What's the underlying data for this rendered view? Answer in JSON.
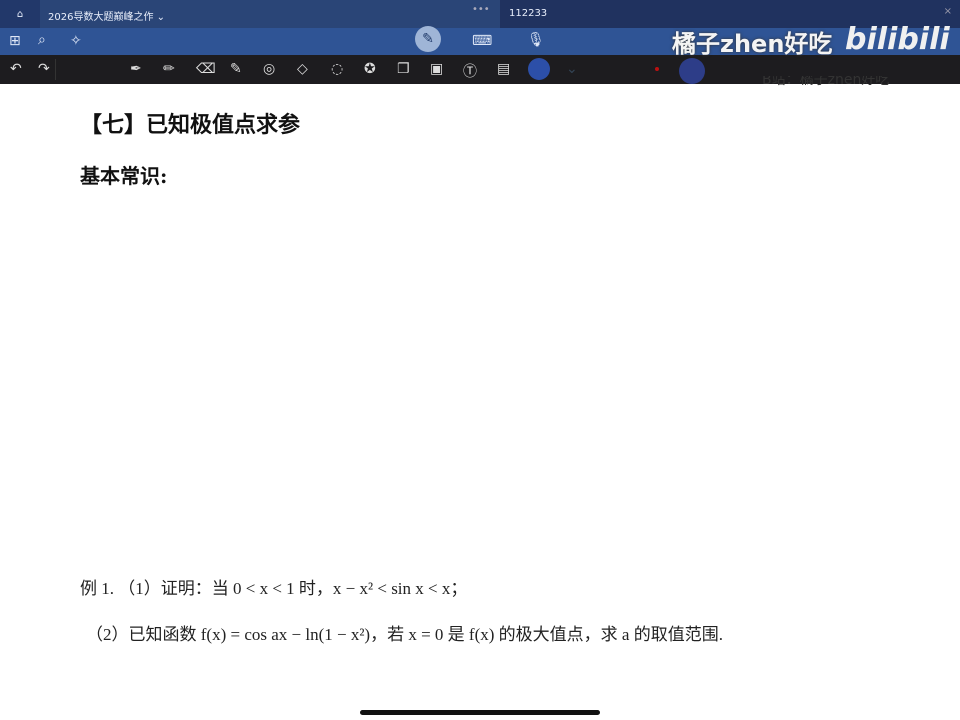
{
  "tabs": {
    "doc_title": "2026导数大题巅峰之作",
    "second_tab": "112233",
    "more": "•••",
    "close": "×"
  },
  "watermark": {
    "author": "橘子zhen好吃",
    "logo": "bilibili",
    "credit": "B站：橘子zhen好吃"
  },
  "content": {
    "heading": "【七】已知极值点求参",
    "subheading": "基本常识:",
    "example1_line1": "例 1. （1）证明：当 0 < x < 1 时，x − x² < sin x < x；",
    "example1_line2": "（2）已知函数 f(x) = cos ax − ln(1 − x²)，若 x = 0 是 f(x) 的极大值点，求 a 的取值范围."
  }
}
